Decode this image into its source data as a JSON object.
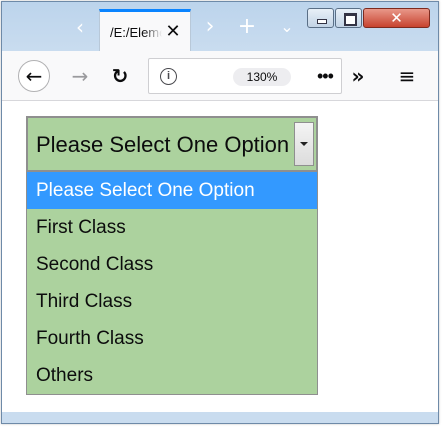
{
  "tab": {
    "title": "/E:/Elements"
  },
  "toolbar": {
    "zoom": "130%"
  },
  "icons": {
    "tab_scroll_left": "chevron-left-icon",
    "tab_scroll_right": "chevron-right-icon",
    "new_tab": "plus-icon",
    "tab_list": "chevron-down-icon",
    "back": "arrow-left-icon",
    "forward": "arrow-right-icon",
    "reload": "reload-icon",
    "site_info": "info-icon",
    "page_actions": "ellipsis-icon",
    "overflow": "double-chevron-right-icon",
    "menu": "hamburger-menu-icon"
  },
  "select": {
    "selected": "Please Select One Option",
    "options": [
      "Please Select One Option",
      "First Class",
      "Second Class",
      "Third Class",
      "Fourth Class",
      "Others"
    ],
    "highlighted_index": 0
  },
  "colors": {
    "select_background": "#acd29e",
    "highlight": "#3399ff",
    "tab_accent": "#0a84ff",
    "close_button": "#c7432f"
  }
}
